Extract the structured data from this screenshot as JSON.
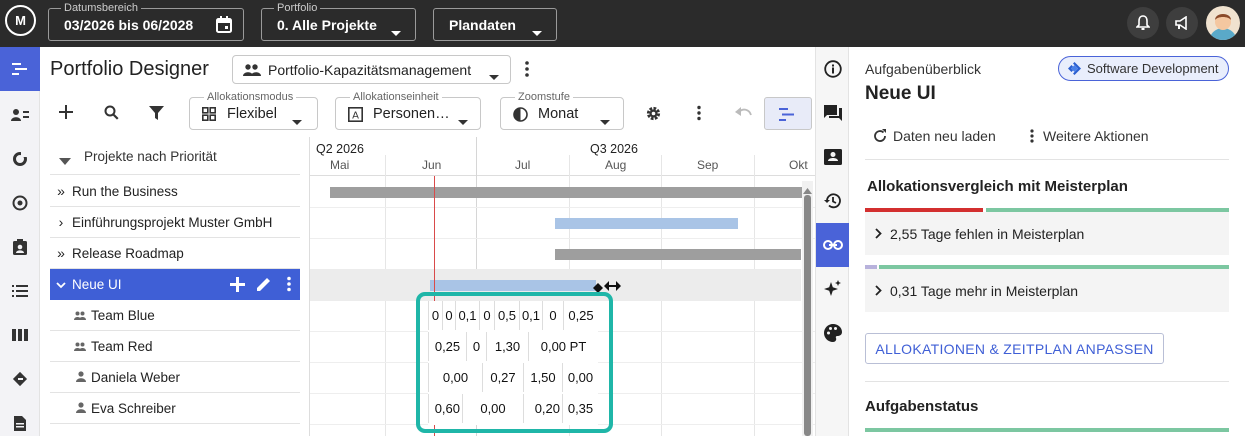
{
  "topbar": {
    "date_range_label": "Datumsbereich",
    "date_range_value": "03/2026 bis 06/2028",
    "portfolio_label": "Portfolio",
    "portfolio_value": "0. Alle Projekte",
    "plan_data_label": "Plandaten"
  },
  "header": {
    "title": "Portfolio Designer",
    "view_select": "Portfolio-Kapazitätsmanagement"
  },
  "toolbar": {
    "alloc_mode_label": "Allokationsmodus",
    "alloc_mode_value": "Flexibel",
    "alloc_unit_label": "Allokationseinheit",
    "alloc_unit_value": "Personen…",
    "zoom_label": "Zoomstufe",
    "zoom_value": "Monat"
  },
  "tree": {
    "header": "Projekte nach Priorität",
    "rows": [
      {
        "label": "Run the Business"
      },
      {
        "label": "Einführungsprojekt Muster GmbH"
      },
      {
        "label": "Release Roadmap"
      },
      {
        "label": "Neue UI"
      },
      {
        "label": "Team Blue"
      },
      {
        "label": "Team Red"
      },
      {
        "label": "Daniela Weber"
      },
      {
        "label": "Eva Schreiber"
      }
    ]
  },
  "timeline": {
    "quarters": [
      "Q2 2026",
      "Q3 2026"
    ],
    "months": [
      "Mai",
      "Jun",
      "Jul",
      "Aug",
      "Sep",
      "Okt"
    ]
  },
  "allocations": {
    "team_blue": [
      "0",
      "0",
      "0,1",
      "0",
      "0,5",
      "0,1",
      "0",
      "0,25"
    ],
    "team_red": [
      "0,25",
      "0",
      "1,30",
      "0,00 PT"
    ],
    "daniela": [
      "0,00",
      "0,27",
      "1,50",
      "0,00"
    ],
    "eva": [
      "0,60",
      "0,00",
      "0,20",
      "0,35"
    ]
  },
  "panel": {
    "overview_label": "Aufgabenüberblick",
    "badge": "Software Development",
    "task_title": "Neue UI",
    "reload": "Daten neu laden",
    "more_actions": "Weitere Aktionen",
    "compare_heading": "Allokationsvergleich mit Meisterplan",
    "missing_days": "2,55 Tage fehlen in Meisterplan",
    "extra_days": "0,31 Tage mehr in Meisterplan",
    "adjust_button": "ALLOKATIONEN & ZEITPLAN ANPASSEN",
    "status_heading": "Aufgabenstatus"
  },
  "colors": {
    "accent": "#4a63d8",
    "highlight": "#1fb6a8",
    "selected_row": "#3f5fd6",
    "bar_gray": "#9e9e9e",
    "bar_blue": "#a9c4e6",
    "red_progress": "#d32f2f",
    "green_progress": "#7cc7a1"
  }
}
